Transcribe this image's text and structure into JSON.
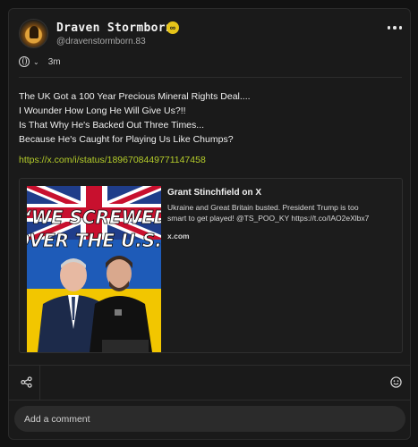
{
  "post": {
    "author": {
      "display_name": "Draven Stormborn",
      "handle": "@dravenstormborn.83",
      "badge_glyph": "∞",
      "badge_color": "#e6c419"
    },
    "meta": {
      "visibility_icon": "globe-icon",
      "time_ago": "3m"
    },
    "body_lines": [
      "The UK Got a 100 Year Precious Mineral Rights Deal....",
      "I Wounder How Long He Will Give Us?!!",
      "Is That Why He's Backed Out Three Times...",
      "Because He's Caught for Playing Us Like Chumps?"
    ],
    "link": "https://x.com/i/status/1896708449771147458",
    "link_color": "#b4cc2a",
    "embed": {
      "title": "Grant Stinchfield on X",
      "description": "Ukraine and Great Britain busted. President Trump is too\nsmart to get played! @TS_POO_KY https://t.co/IAO2eXlbx7",
      "domain": "x.com",
      "image_headline": "\"WE SCREWED\nOVER THE U.S.\""
    }
  },
  "actions": {
    "share_icon": "share-icon",
    "emoji_icon": "emoji-icon",
    "more_icon": "more-options-icon"
  },
  "comment": {
    "placeholder": "Add a comment"
  }
}
